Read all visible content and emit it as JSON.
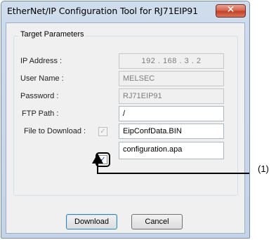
{
  "window": {
    "title": "EtherNet/IP Configuration Tool for RJ71EIP91",
    "close_glyph": "✕"
  },
  "group": {
    "title": "Target Parameters"
  },
  "fields": {
    "ip_address": {
      "label": "IP Address :",
      "octets": [
        "192",
        "168",
        "3",
        "2"
      ],
      "separator": ".",
      "enabled": false
    },
    "user_name": {
      "label": "User Name :",
      "value": "MELSEC",
      "enabled": false
    },
    "password": {
      "label": "Password :",
      "value": "RJ71EIP91",
      "enabled": false
    },
    "ftp_path": {
      "label": "FTP Path :",
      "value": "/",
      "enabled": true
    },
    "file_to_download": {
      "label": "File to Download :",
      "files": [
        {
          "name": "EipConfData.BIN",
          "checked": true,
          "enabled": false
        },
        {
          "name": "configuration.apa",
          "checked": true,
          "enabled": true
        }
      ]
    }
  },
  "buttons": {
    "download": "Download",
    "cancel": "Cancel"
  },
  "annotation": {
    "label": "(1)"
  },
  "colors": {
    "callout": "#000000",
    "close_button": "#c1412a",
    "check_mark": "#2a4a9a"
  },
  "icons": {
    "check": "check-mark-icon",
    "close": "close-icon",
    "arrow": "arrow-up-icon"
  }
}
